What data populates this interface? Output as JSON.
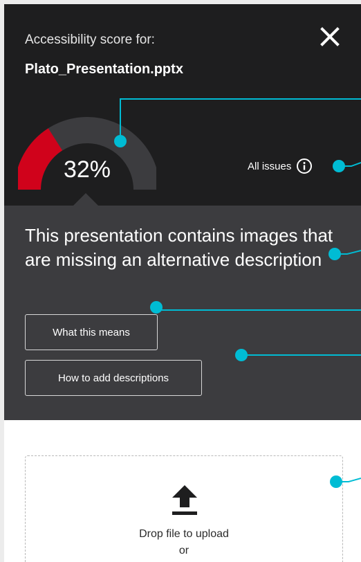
{
  "header": {
    "score_label": "Accessibility score for:",
    "file_name": "Plato_Presentation.pptx"
  },
  "score": {
    "value": 0.32,
    "display": "32%",
    "fill_color": "#d0021b",
    "track_color": "#3c3c3f"
  },
  "issues_link": {
    "label": "All issues"
  },
  "issue": {
    "message": "This presentation contains images that are missing an alternative description",
    "actions": [
      {
        "label": "What this means"
      },
      {
        "label": "How to add descriptions"
      }
    ]
  },
  "upload": {
    "drop_label": "Drop file to upload",
    "or_label": "or"
  },
  "colors": {
    "header_bg": "#1e1e1f",
    "issue_bg": "#3c3c3f",
    "callout": "#00bcd4"
  }
}
